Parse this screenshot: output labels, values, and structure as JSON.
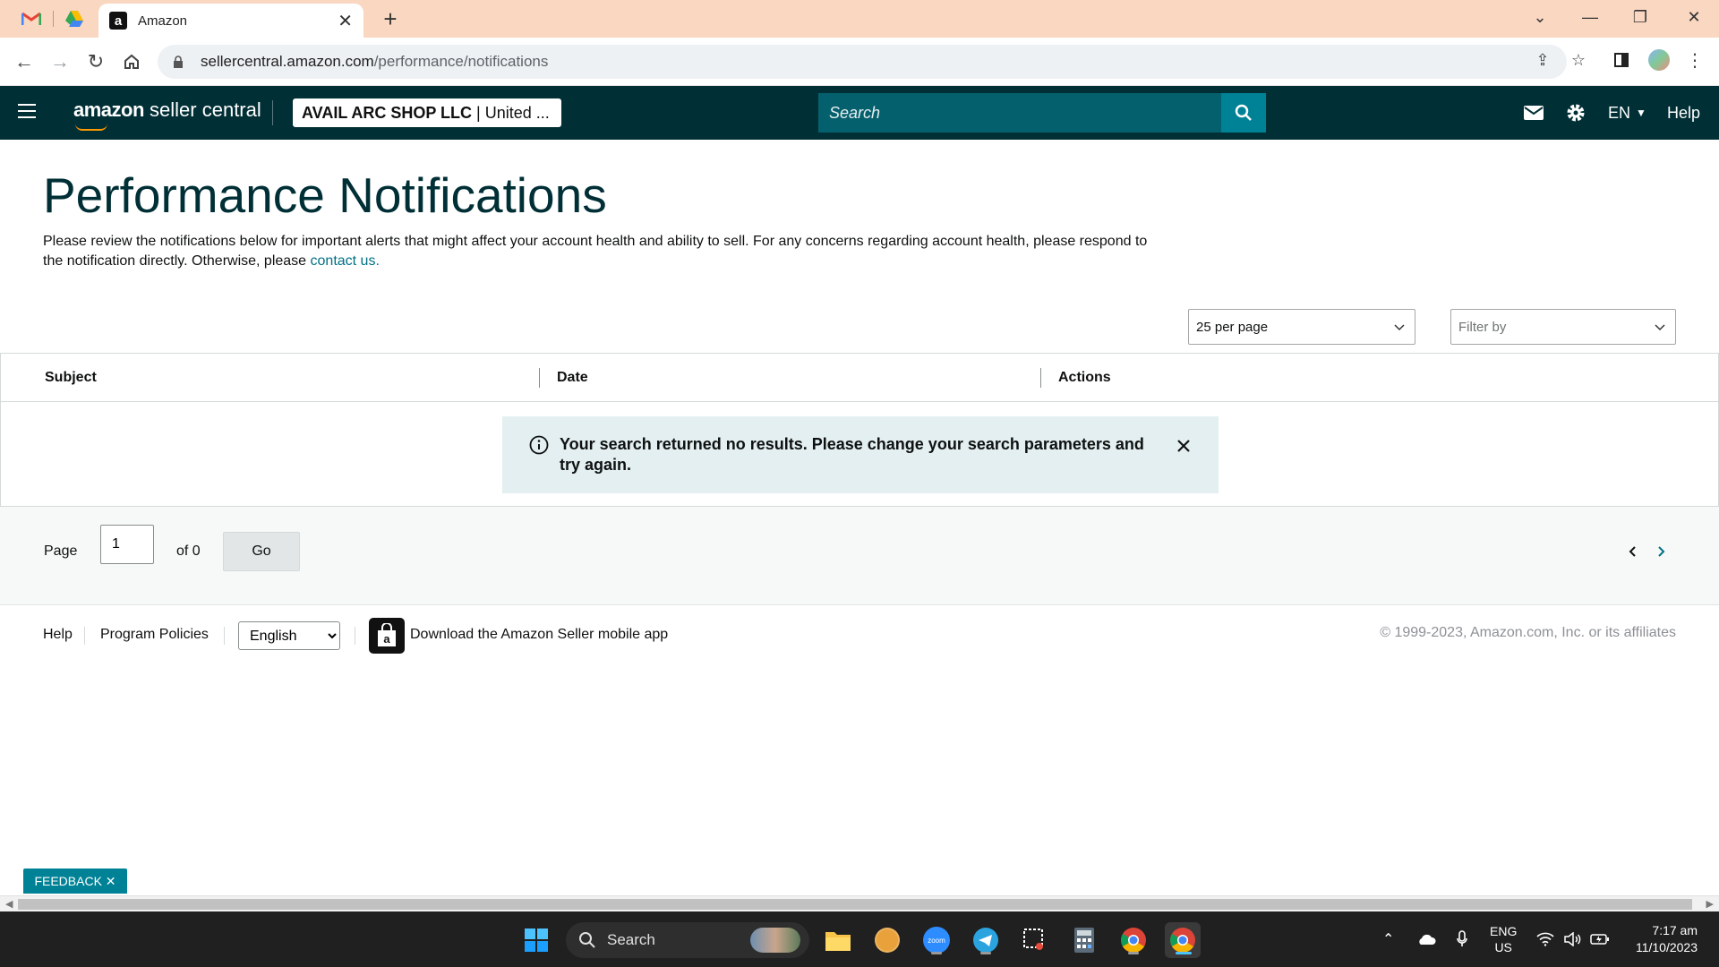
{
  "browser": {
    "active_tab_title": "Amazon",
    "url_host": "sellercentral.amazon.com",
    "url_path": "/performance/notifications"
  },
  "header": {
    "brand_bold": "amazon",
    "brand_rest": " seller central",
    "account_name": "AVAIL ARC SHOP LLC",
    "account_region": "| United ...",
    "search_placeholder": "Search",
    "language": "EN",
    "help": "Help"
  },
  "page": {
    "title": "Performance Notifications",
    "intro_text": "Please review the notifications below for important alerts that might affect your account health and ability to sell. For any concerns regarding account health, please respond to the notification directly. Otherwise, please ",
    "intro_link": "contact us.",
    "per_page": "25 per page",
    "filter_placeholder": "Filter by"
  },
  "table": {
    "columns": [
      "Subject",
      "Date",
      "Actions"
    ],
    "empty_message": "Your search returned no results. Please change your search parameters and try again."
  },
  "pager": {
    "page_label": "Page",
    "page_value": "1",
    "of_label": "of 0",
    "go_label": "Go"
  },
  "footer": {
    "help": "Help",
    "program_policies": "Program Policies",
    "language_selected": "English",
    "app_text": "Download the Amazon Seller mobile app",
    "copyright": "© 1999-2023, Amazon.com, Inc. or its affiliates"
  },
  "feedback": "FEEDBACK ✕",
  "taskbar": {
    "search": "Search",
    "lang_top": "ENG",
    "lang_bottom": "US",
    "time": "7:17 am",
    "date": "11/10/2023"
  },
  "colors": {
    "header_bg": "#002f36",
    "search_bg": "#05606e",
    "accent_teal": "#008296",
    "alert_bg": "#e3eff0",
    "tab_strip": "#f9d7c1"
  }
}
